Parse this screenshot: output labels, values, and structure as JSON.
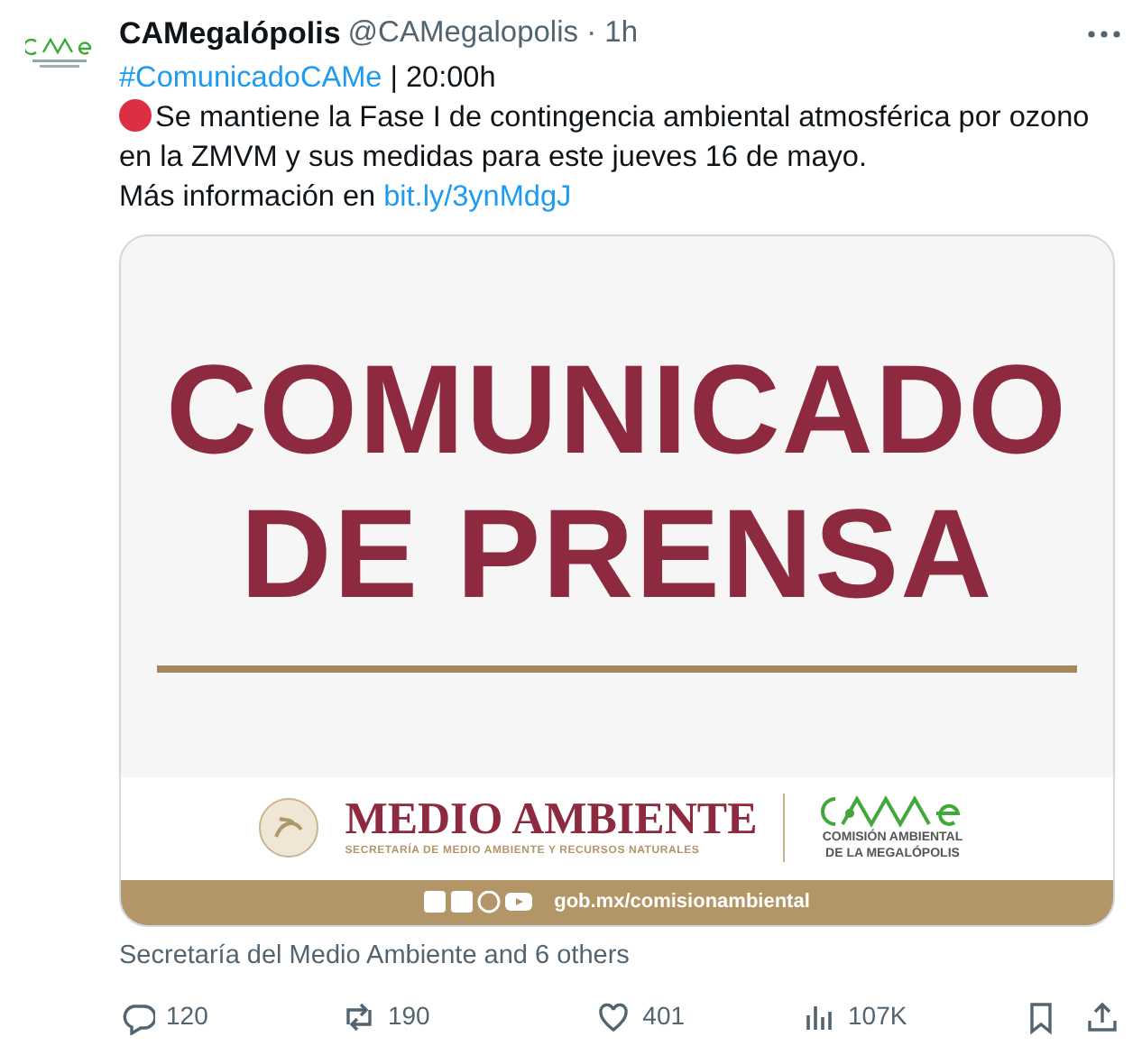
{
  "tweet": {
    "author": {
      "name": "CAMegalópolis",
      "handle_line": "@CAMegalopolis · 1h"
    },
    "lines": [
      {
        "link": "#ComunicadoCAMe",
        "text": " | 20:00h"
      },
      {
        "alert": true,
        "text": "Se mantiene la Fase I de contingencia ambiental atmosférica por ozono en la ZMVM y sus medidas para este jueves 16 de mayo."
      },
      {
        "text": "Más información en ",
        "link": "bit.ly/3ynMdgJ"
      }
    ],
    "media": {
      "headline": [
        "COMUNICADO",
        "DE PRENSA"
      ],
      "brand": "MEDIO AMBIENTE",
      "brand_sub": "SECRETARÍA DE MEDIO AMBIENTE Y RECURSOS NATURALES",
      "came_sub": "COMISIÓN AMBIENTAL DE LA MEGALÓPOLIS",
      "url": "gob.mx/comisionambiental"
    },
    "tagged": "Secretaría del Medio Ambiente and 6 others",
    "actions": [
      {
        "kind": "reply",
        "count": "120"
      },
      {
        "kind": "retweet",
        "count": "190"
      },
      {
        "kind": "like",
        "count": "401"
      },
      {
        "kind": "views",
        "count": "107K"
      },
      {
        "kind": "bookmark"
      },
      {
        "kind": "share"
      }
    ]
  }
}
